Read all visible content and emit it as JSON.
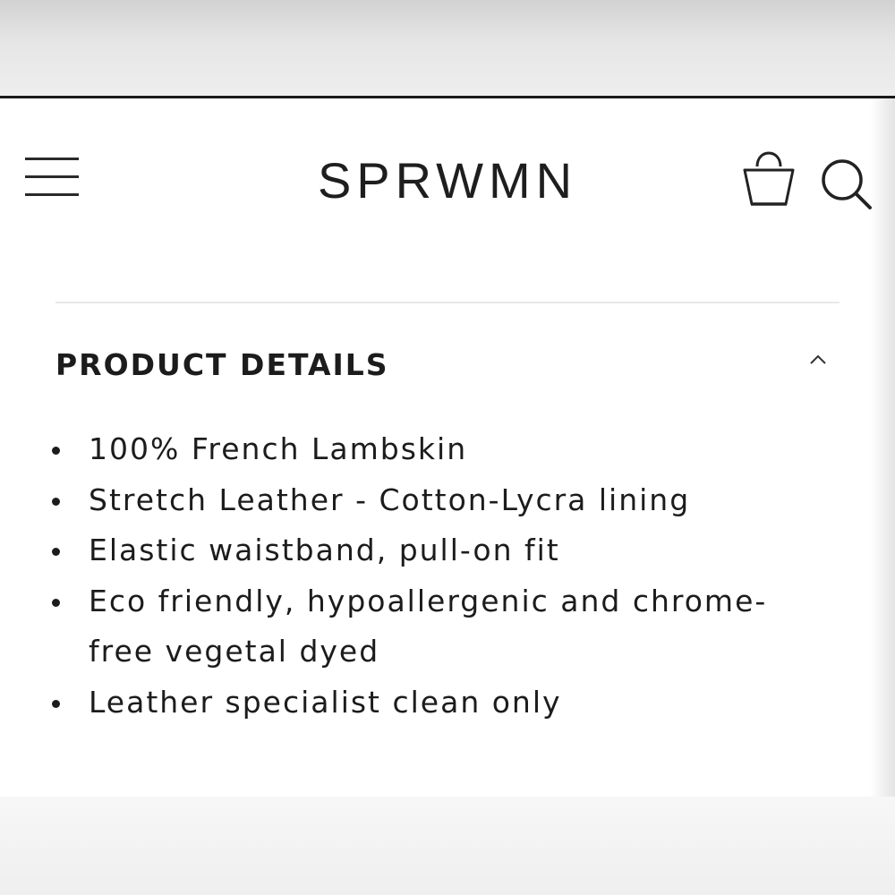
{
  "header": {
    "logo": "SPRWMN",
    "menu_icon": "hamburger-menu-icon",
    "bag_icon": "shopping-bag-icon",
    "search_icon": "search-icon"
  },
  "product_details": {
    "title": "PRODUCT DETAILS",
    "expanded": true,
    "toggle_icon": "chevron-up-icon",
    "items": [
      "100% French Lambskin",
      "Stretch Leather - Cotton-Lycra lining",
      "Elastic waistband, pull-on fit",
      "Eco friendly, hypoallergenic and chrome-free vegetal dyed",
      "Leather specialist clean only"
    ]
  },
  "colors": {
    "text": "#1c1c1c",
    "background": "#ffffff",
    "divider": "#e8e8e8"
  }
}
